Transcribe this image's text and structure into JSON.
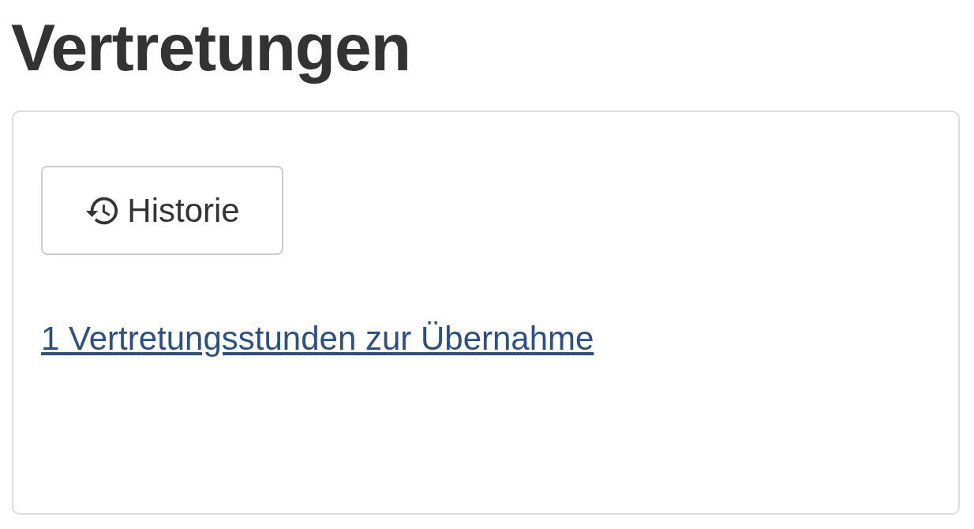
{
  "title": "Vertretungen",
  "panel": {
    "history_button": {
      "label": "Historie"
    },
    "link": "1 Vertretungsstunden zur Übernahme"
  }
}
